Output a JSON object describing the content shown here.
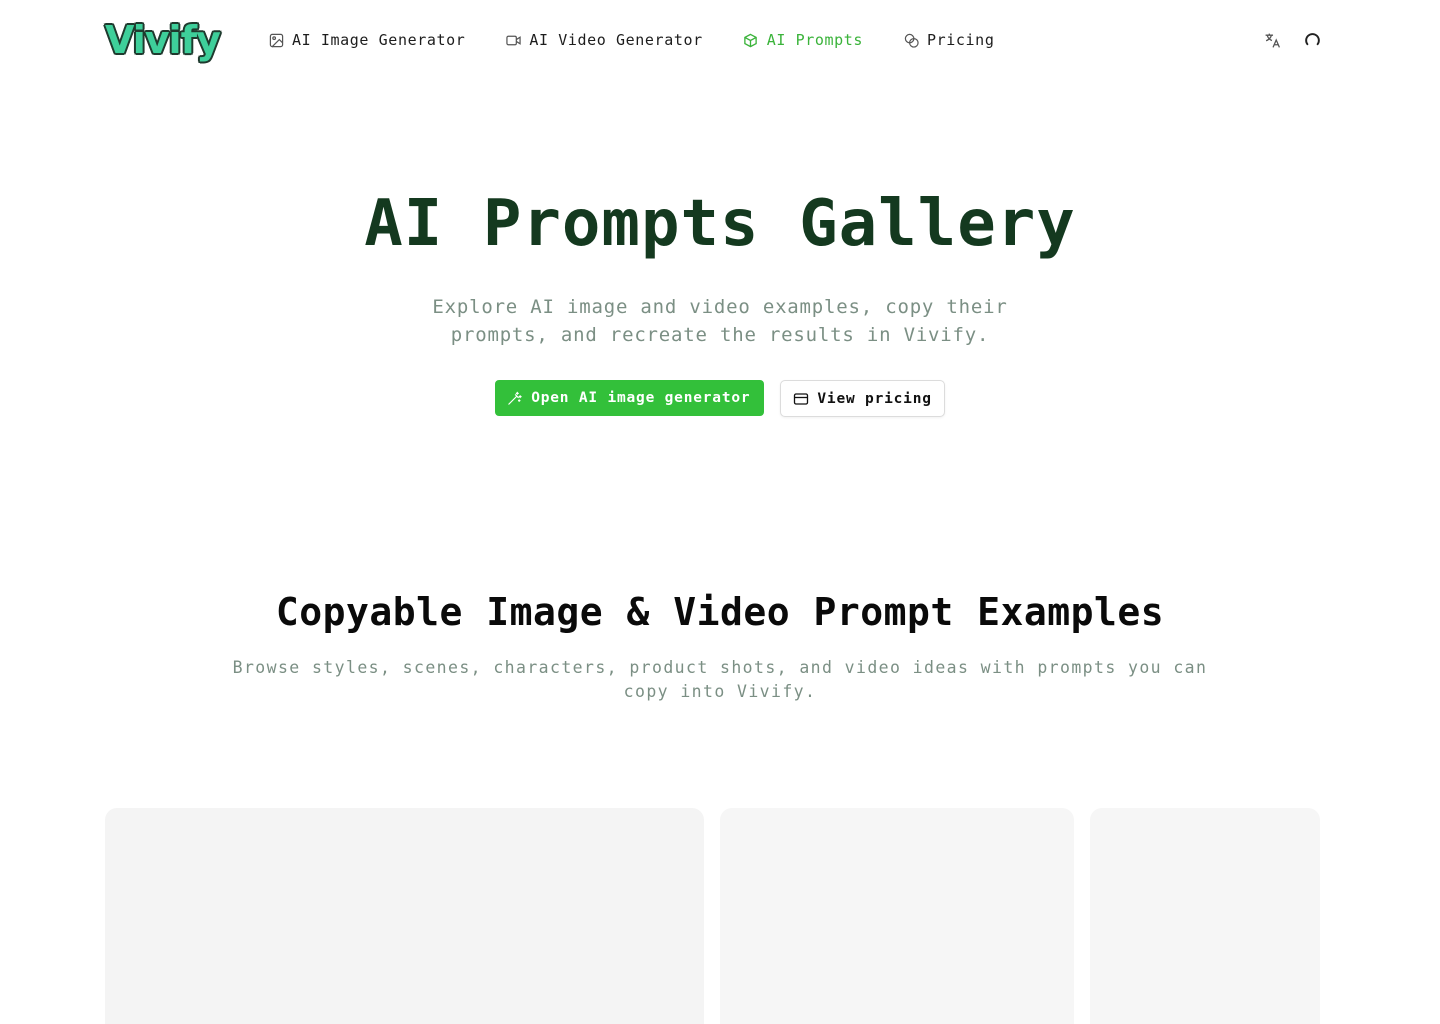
{
  "brand": {
    "name": "Vivify"
  },
  "nav": {
    "items": [
      {
        "label": "AI Image Generator",
        "icon": "image-icon",
        "active": false
      },
      {
        "label": "AI Video Generator",
        "icon": "video-icon",
        "active": false
      },
      {
        "label": "AI Prompts",
        "icon": "box-icon",
        "active": true
      },
      {
        "label": "Pricing",
        "icon": "coins-icon",
        "active": false
      }
    ]
  },
  "header_actions": {
    "language_icon": "translate-icon",
    "account_icon": "loading-spinner-icon"
  },
  "hero": {
    "title": "AI Prompts Gallery",
    "subtitle": "Explore AI image and video examples, copy their prompts, and recreate the results in Vivify.",
    "primary_cta": "Open AI image generator",
    "secondary_cta": "View pricing"
  },
  "section": {
    "title": "Copyable Image & Video Prompt Examples",
    "subtitle": "Browse styles, scenes, characters, product shots, and video ideas with prompts you can copy into Vivify."
  },
  "colors": {
    "accent": "#33c03a",
    "title": "#14391f",
    "muted": "#7b8f84",
    "logo": "#3ecf9a"
  }
}
